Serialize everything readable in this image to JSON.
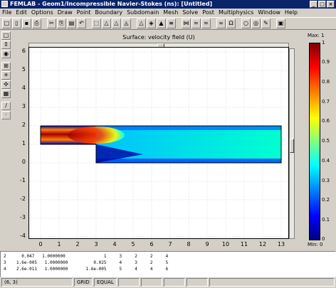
{
  "window": {
    "title": "FEMLAB - Geom1/Incompressible Navier-Stokes (ns): [Untitled]",
    "minimize": "_",
    "maximize": "□",
    "close": "×"
  },
  "menu": [
    "File",
    "Edit",
    "Options",
    "Draw",
    "Point",
    "Boundary",
    "Subdomain",
    "Mesh",
    "Solve",
    "Post",
    "Multiphysics",
    "Window",
    "Help"
  ],
  "toolbar": {
    "main": [
      "□",
      "▯",
      "▪",
      "⎙",
      "✂",
      "⎘",
      "▤",
      "↶",
      "⬚",
      "△",
      "△",
      "◬",
      "△",
      "◈",
      "▲",
      "≡",
      "⋈",
      "≈",
      "≈",
      "∞",
      "Ω",
      "○",
      "◎",
      "✎",
      "▣"
    ]
  },
  "left_tools": [
    "□",
    "⇕",
    "◉",
    "⊞",
    "✳",
    "✣",
    "▦",
    "/",
    "·"
  ],
  "plot": {
    "title": "Surface: velocity field (U)",
    "y_ticks": [
      "6",
      "5",
      "4",
      "3",
      "2",
      "1",
      "0",
      "-1",
      "-2",
      "-3",
      "-4"
    ],
    "x_ticks": [
      "0",
      "1",
      "2",
      "3",
      "4",
      "5",
      "6",
      "7",
      "8",
      "9",
      "10",
      "11",
      "12",
      "13"
    ]
  },
  "colorbar": {
    "max_label": "Max: 1",
    "min_label": "Min: 0",
    "ticks": [
      "1",
      "0.9",
      "0.8",
      "0.7",
      "0.6",
      "0.5",
      "0.4",
      "0.3",
      "0.2",
      "0.1",
      "0"
    ]
  },
  "console": {
    "lines": [
      "2      0.047   1.0000000               1     3     2     2     4",
      "3    1.6e-005   1.0000000          0.025     4     3     2     5",
      "4    2.6e-011   1.0000000       1.6e-005     5     4     4     6"
    ]
  },
  "status": {
    "coords": "(6, 3)",
    "grid": "GRID",
    "equal": "EQUAL"
  }
}
